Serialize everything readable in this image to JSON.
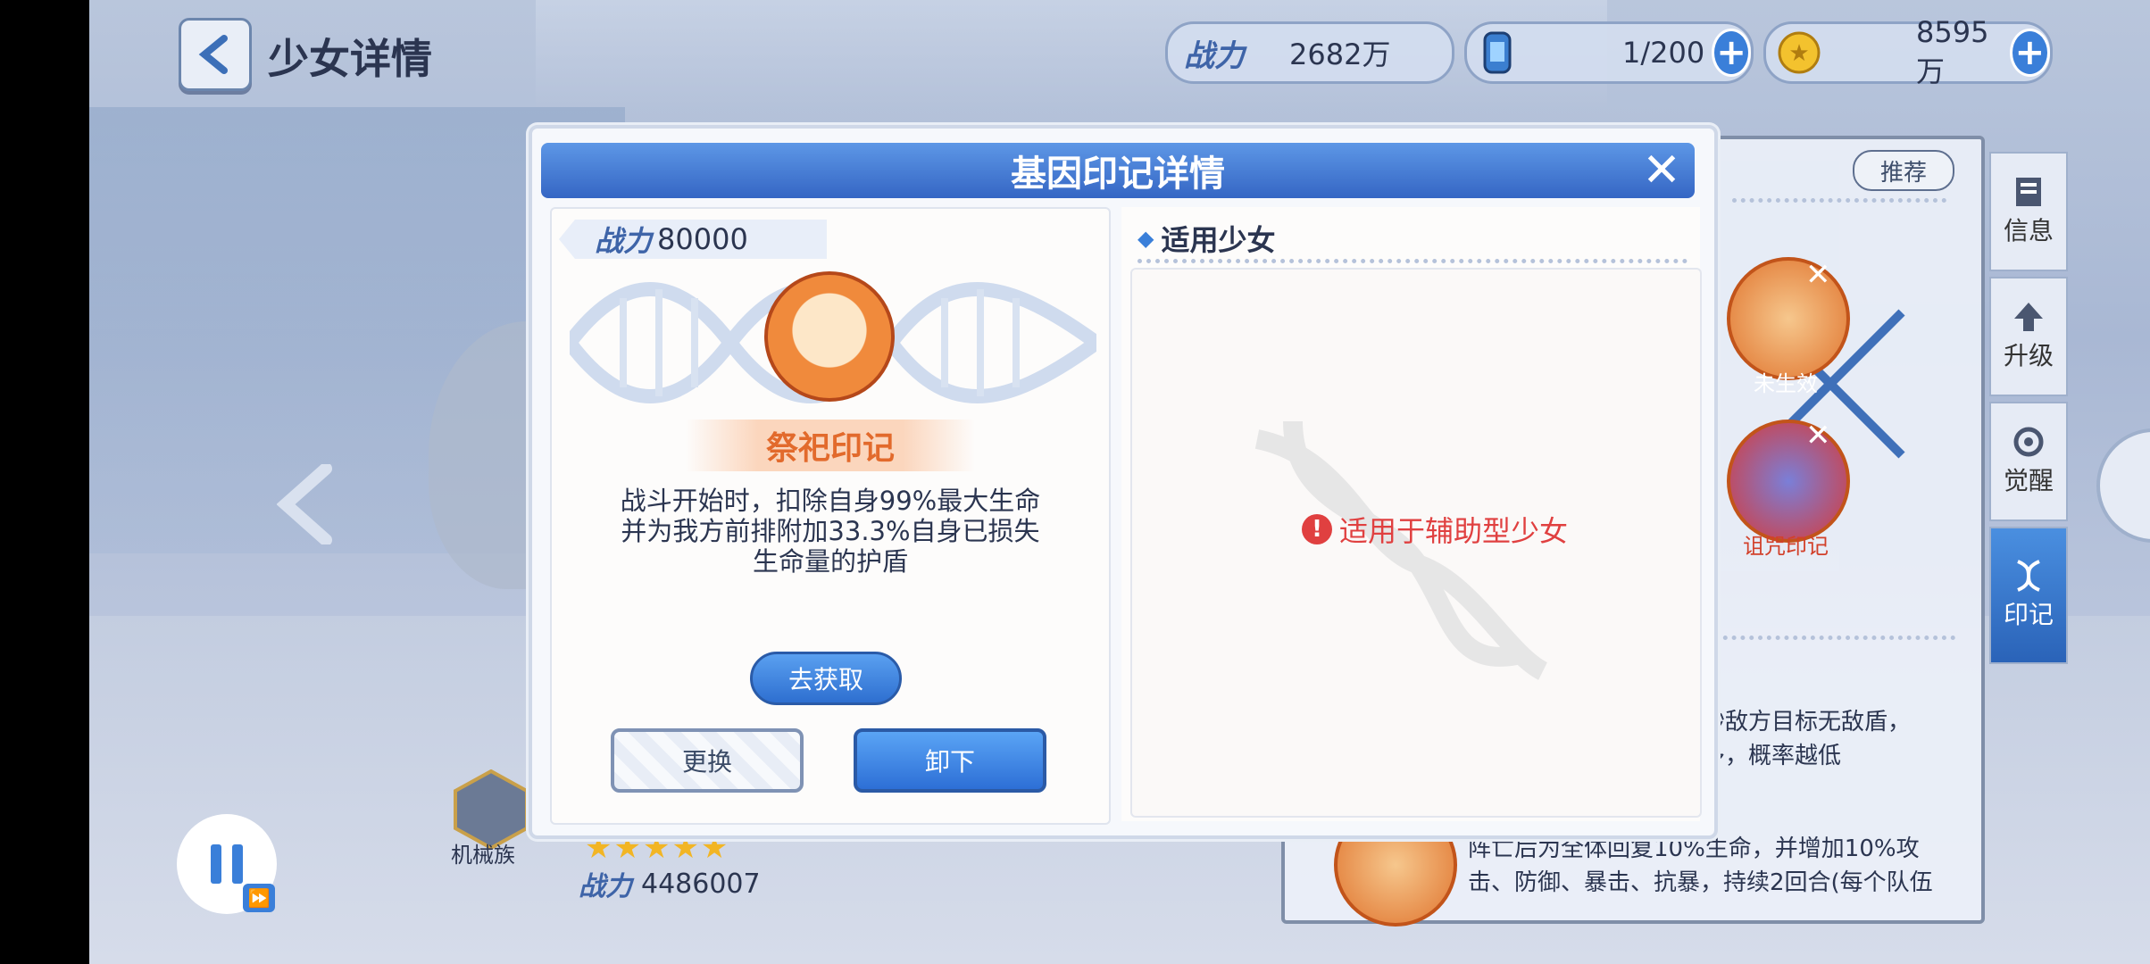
{
  "page": {
    "title": "少女详情"
  },
  "resources": {
    "power_label": "战力",
    "power_value": "2682万",
    "stamina_value": "1/200",
    "gold_value": "8595万"
  },
  "side_tabs": [
    {
      "label": "信息"
    },
    {
      "label": "升级"
    },
    {
      "label": "觉醒"
    },
    {
      "label": "印记"
    }
  ],
  "background_panel": {
    "recommend_label": "推荐",
    "slot1_label": "未生效",
    "slot2_label": "诅咒印记",
    "text1": "秒敌方目标无敌盾，\n多，概率越低",
    "text2": "阵亡后为全体回复10%生命，并增加10%攻\n击、防御、暴击、抗暴，持续2回合(每个队伍"
  },
  "character": {
    "race": "机械族",
    "stars": "★★★★★",
    "power_label": "战力",
    "power_value": "4486007"
  },
  "modal": {
    "title": "基因印记详情",
    "power_label": "战力",
    "power_value": "80000",
    "mark_name": "祭祀印记",
    "description": "战斗开始时，扣除自身99%最大生命并为我方前排附加33.3%自身已损失生命量的护盾",
    "get_button": "去获取",
    "replace_button": "更换",
    "unequip_button": "卸下",
    "applicable_title": "适用少女",
    "applicable_hint": "适用于辅助型少女"
  },
  "colors": {
    "modal_header": "#3566c4",
    "accent_orange": "#e26a2c",
    "warning_red": "#e04040"
  }
}
